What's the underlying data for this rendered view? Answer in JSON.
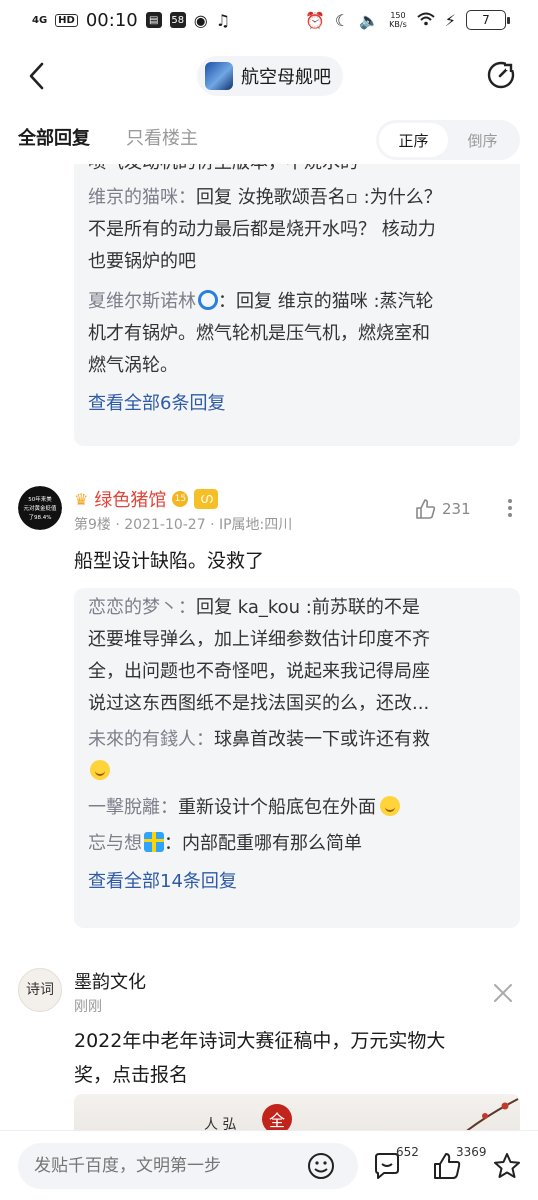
{
  "status_bar": {
    "signal": "4G",
    "hd": "HD",
    "time": "00:10",
    "notif_count": "58",
    "net_speed_value": "150",
    "net_speed_unit": "KB/s",
    "battery": "7"
  },
  "nav": {
    "forum_name": "航空母舰吧"
  },
  "tabs": {
    "all_replies": "全部回复",
    "op_only": "只看楼主",
    "order_asc": "正序",
    "order_desc": "倒序"
  },
  "prev_block": {
    "partial_line": "喷气发动机的衍生版本，不烧水的",
    "replies": [
      {
        "user": "维京的猫咪：",
        "lines": [
          "回复 汝挽歌颂吾名▫ :为什么？",
          "不是所有的动力最后都是烧开水吗？ 核动力",
          "也要锅炉的吧"
        ]
      },
      {
        "user": "夏维尔斯诺林",
        "lines": [
          "：回复 维京的猫咪 :蒸汽轮",
          "机才有锅炉。燃气轮机是压气机，燃烧室和",
          "燃气涡轮。"
        ]
      }
    ],
    "view_all": "查看全部6条回复"
  },
  "post_9": {
    "avatar_lines": [
      "50年来美",
      "元对黄金贬值",
      "了98.4%"
    ],
    "author": "绿色猪馆",
    "level": "15",
    "meta": "第9楼 · 2021-10-27 · IP属地:四川",
    "likes": "231",
    "text": "船型设计缺陷。没救了",
    "replies": [
      {
        "user": "恋恋的梦丶：",
        "lines": [
          "回复 ka_kou :前苏联的不是",
          "还要堆导弹么，加上详细参数估计印度不齐",
          "全，出问题也不奇怪吧，说起来我记得局座",
          "说过这东西图纸不是找法国买的么，还改..."
        ]
      },
      {
        "user": "未來的有錢人：",
        "lines": [
          "球鼻首改装一下或许还有救"
        ]
      },
      {
        "user": "一擊脫離：",
        "lines": [
          "重新设计个船底包在外面"
        ]
      },
      {
        "user": "忘与想",
        "lines": [
          "：内部配重哪有那么简单"
        ]
      }
    ],
    "view_all": "查看全部14条回复"
  },
  "ad_post": {
    "author": "墨韵文化",
    "avatar_text": "诗词",
    "meta": "刚刚",
    "text_line1": "2022年中老年诗词大赛征稿中，万元实物大",
    "text_line2": "奖，点击报名",
    "banner_text": "人 弘",
    "banner_seal": "全"
  },
  "bottom_bar": {
    "input_placeholder": "发贴千百度，文明第一步",
    "comment_count": "652",
    "like_count": "3369"
  }
}
